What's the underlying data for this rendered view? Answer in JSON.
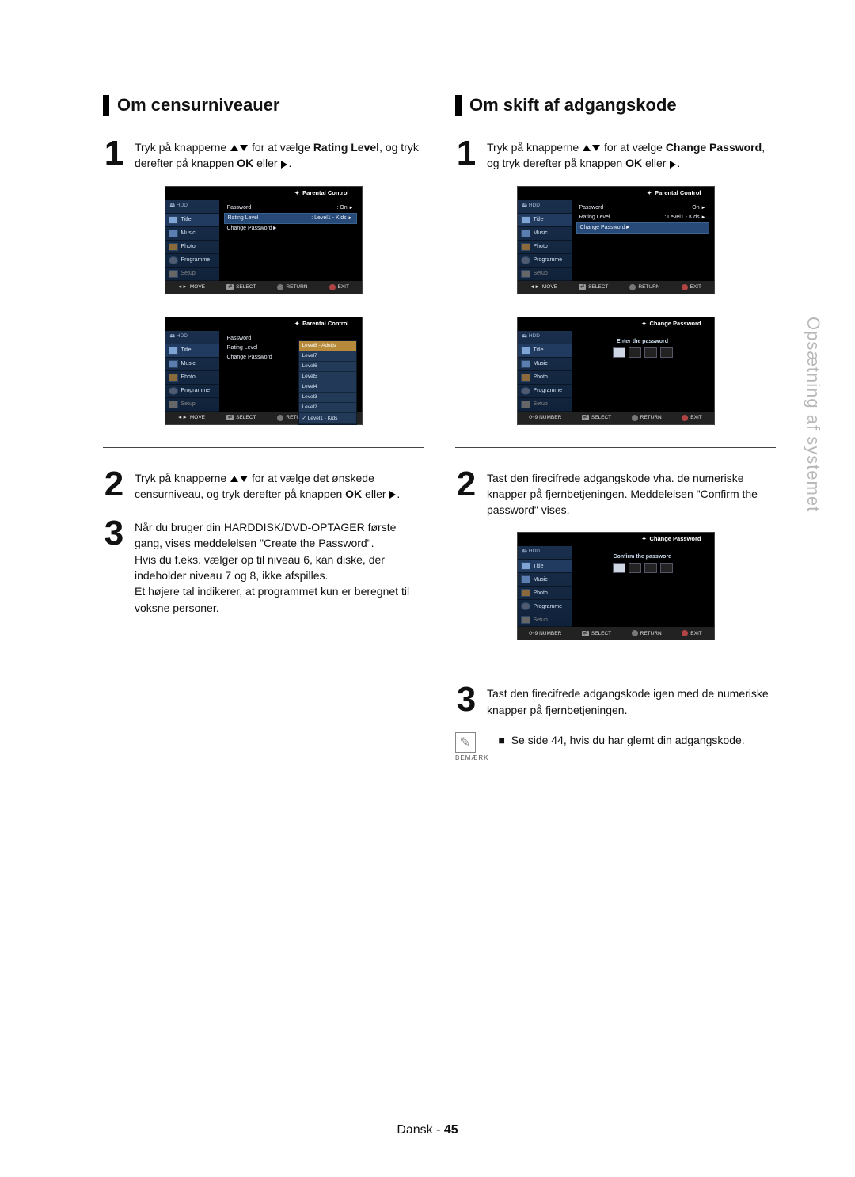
{
  "side_label": "Opsætning af systemet",
  "footer": {
    "lang": "Dansk",
    "sep": " - ",
    "page": "45"
  },
  "left": {
    "title": "Om censurniveauer",
    "step1_a": "Tryk på knapperne ",
    "step1_b": " for at vælge ",
    "step1_bold": "Rating Level",
    "step1_c": ", og tryk derefter på knappen ",
    "step1_bold2": "OK",
    "step1_d": " eller ",
    "step2_a": "Tryk på knapperne ",
    "step2_b": " for at vælge det ønskede censurniveau, og tryk derefter på knappen ",
    "step2_bold": "OK",
    "step2_c": " eller ",
    "step3": "Når du bruger din HARDDISK/DVD-OPTAGER første gang, vises meddelelsen \"Create the Password\".\nHvis du f.eks. vælger op til niveau 6, kan diske, der indeholder niveau 7 og 8, ikke afspilles.\nEt højere tal indikerer, at programmet kun er beregnet til voksne personer."
  },
  "right": {
    "title": "Om skift af adgangskode",
    "step1_a": "Tryk på knapperne ",
    "step1_b": " for at vælge ",
    "step1_bold": "Change Password",
    "step1_c": ", og tryk derefter på knappen ",
    "step1_bold2": "OK",
    "step1_d": " eller ",
    "step2": "Tast den firecifrede adgangskode vha. de numeriske knapper på fjernbetjeningen. Meddelelsen \"Confirm the password\" vises.",
    "step3": "Tast den firecifrede adgangskode igen med de numeriske knapper på fjernbetjeningen.",
    "note_bullet": "■",
    "note_label": "BEMÆRK",
    "note": "Se side 44, hvis du har glemt din adgangskode."
  },
  "osd": {
    "pc_title": "Parental Control",
    "cp_title": "Change Password",
    "hdd": "HDD",
    "menu": {
      "title": "Title",
      "music": "Music",
      "photo": "Photo",
      "programme": "Programme",
      "setup": "Setup"
    },
    "lines": {
      "password": "Password",
      "on": ": On",
      "rating": "Rating Level",
      "rating_val": ": Level1 - Kids",
      "change": "Change Password"
    },
    "levels": [
      "Level8 - Adults",
      "Level7",
      "Level6",
      "Level5",
      "Level4",
      "Level3",
      "Level2",
      "Level1 - Kids"
    ],
    "prompt_enter": "Enter the password",
    "prompt_confirm": "Confirm the password",
    "foot": {
      "move": "MOVE",
      "num": "0~9 NUMBER",
      "select": "SELECT",
      "return": "RETURN",
      "exit": "EXIT"
    }
  }
}
